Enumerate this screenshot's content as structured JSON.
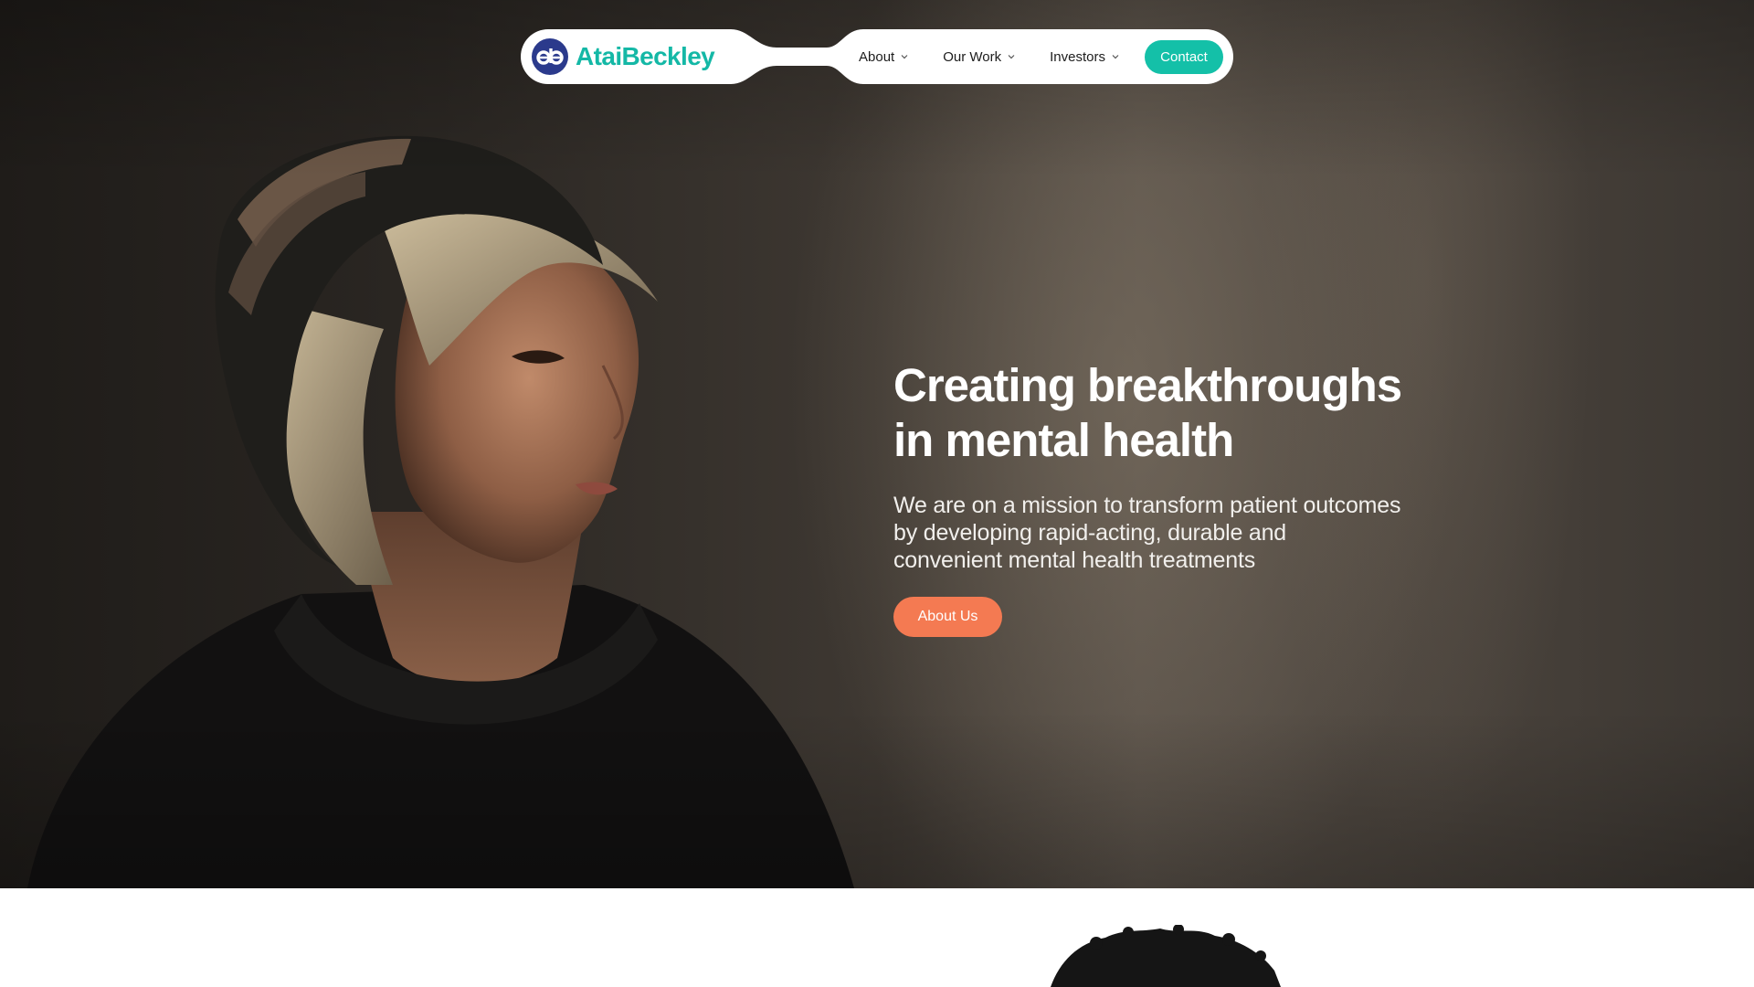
{
  "nav": {
    "brand": {
      "name": "AtaiBeckley",
      "logo_icon": "ab-monogram-icon"
    },
    "items": [
      {
        "label": "About",
        "icon": "chevron-down-icon"
      },
      {
        "label": "Our Work",
        "icon": "chevron-down-icon"
      },
      {
        "label": "Investors",
        "icon": "chevron-down-icon"
      }
    ],
    "contact_label": "Contact"
  },
  "hero": {
    "title_line1": "Creating breakthroughs",
    "title_line2": "in mental health",
    "subtitle_line1": "We are on a mission to transform patient outcomes",
    "subtitle_line2": "by developing rapid-acting, durable and",
    "subtitle_line3": "convenient mental health treatments",
    "cta_label": "About Us",
    "image": "portrait-photo"
  },
  "colors": {
    "brand_teal": "#14b8a6",
    "contact_teal": "#14c0a8",
    "logo_navy": "#2b3a8c",
    "cta_orange": "#f47a52",
    "text_dark": "#1c1c1c"
  }
}
